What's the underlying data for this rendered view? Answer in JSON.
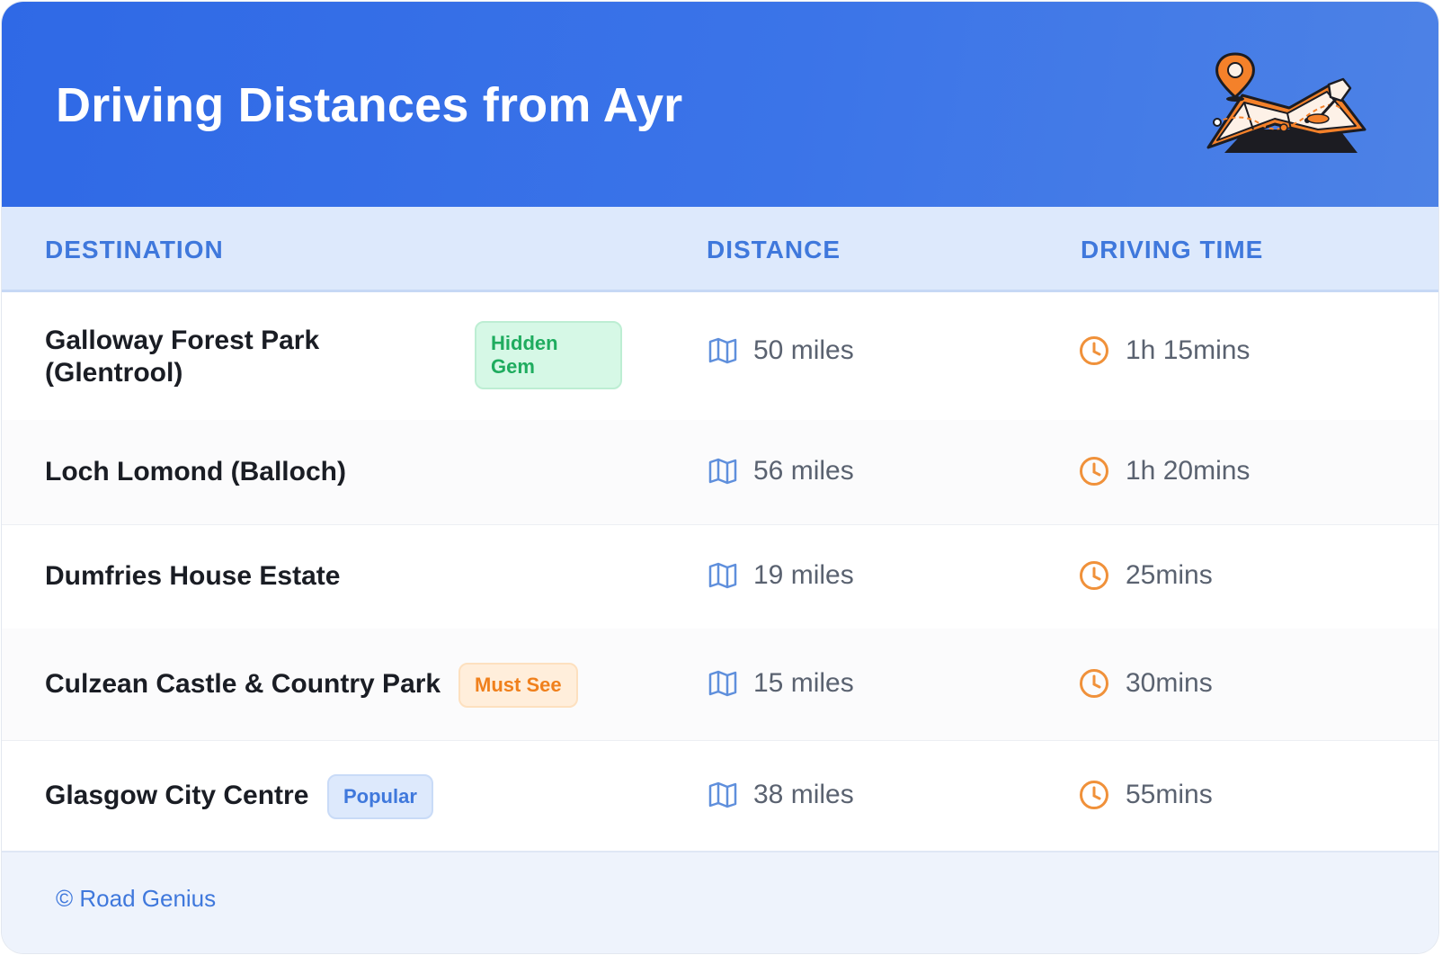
{
  "header": {
    "title": "Driving Distances from Ayr"
  },
  "illustration": "map-with-pins-illustration",
  "columns": {
    "destination": "DESTINATION",
    "distance": "DISTANCE",
    "time": "DRIVING TIME"
  },
  "rows": [
    {
      "destination": "Galloway Forest Park (Glentrool)",
      "badge": "Hidden Gem",
      "badge_style": "green",
      "distance": "50 miles",
      "time": "1h 15mins"
    },
    {
      "destination": "Loch Lomond (Balloch)",
      "badge": "",
      "distance": "56 miles",
      "time": "1h 20mins"
    },
    {
      "destination": "Dumfries House Estate",
      "badge": "",
      "distance": "19 miles",
      "time": "25mins"
    },
    {
      "destination": "Culzean Castle & Country Park",
      "badge": "Must See",
      "badge_style": "orange",
      "distance": "15 miles",
      "time": "30mins"
    },
    {
      "destination": "Glasgow City Centre",
      "badge": "Popular",
      "badge_style": "blue",
      "distance": "38 miles",
      "time": "55mins"
    }
  ],
  "icons": {
    "distance": "map-icon",
    "time": "clock-icon"
  },
  "footer": {
    "text": "© Road Genius"
  },
  "colors": {
    "header_start": "#2f69e6",
    "header_end": "#4d82e6",
    "accent": "#3f78dc",
    "clock": "#f0913a",
    "map": "#5f8fdc",
    "badge_green": "#1fac5f",
    "badge_orange": "#f0801c"
  }
}
